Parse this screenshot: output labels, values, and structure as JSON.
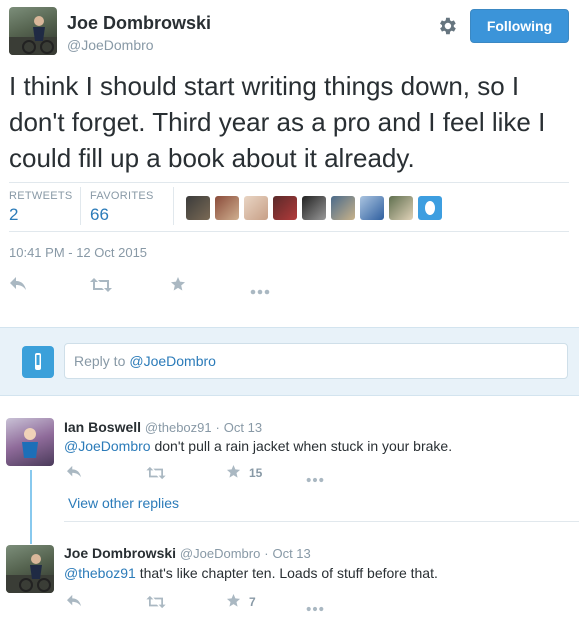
{
  "tweet": {
    "author_name": "Joe Dombrowski",
    "author_handle": "@JoeDombro",
    "follow_label": "Following",
    "text": "I think I should start writing things down, so I don't forget. Third year as a pro and I feel like I could fill up a book about it already.",
    "retweets_label": "RETWEETS",
    "retweets_count": "2",
    "favorites_label": "FAVORITES",
    "favorites_count": "66",
    "timestamp": "10:41 PM - 12 Oct 2015"
  },
  "reply_box": {
    "prefix": "Reply to",
    "mention": "@JoeDombro"
  },
  "replies": [
    {
      "author_name": "Ian Boswell",
      "author_handle": "@theboz91",
      "separator": "·",
      "date": "Oct 13",
      "mention": "@JoeDombro",
      "text": " don't pull a rain jacket when stuck in your brake.",
      "favorite_count": "15"
    },
    {
      "author_name": "Joe Dombrowski",
      "author_handle": "@JoeDombro",
      "separator": "·",
      "date": "Oct 13",
      "mention": "@theboz91",
      "text": " that's like chapter ten. Loads of stuff before that.",
      "favorite_count": "7"
    }
  ],
  "view_other_replies": "View other replies",
  "icons": {
    "gear": "gear-icon",
    "reply": "reply-icon",
    "retweet": "retweet-icon",
    "favorite": "star-icon",
    "more": "more-icon"
  },
  "colors": {
    "link": "#2b7bb9",
    "follow_button": "#3b94d9",
    "reply_area": "#e8f2f9",
    "icon": "#aab8c2"
  }
}
